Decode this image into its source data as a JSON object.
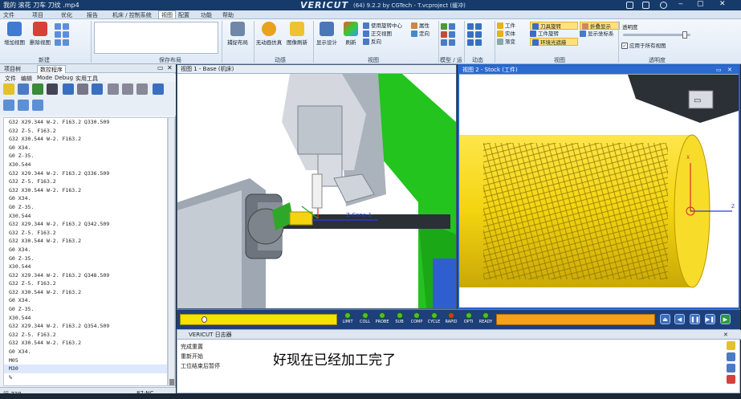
{
  "window": {
    "file_title": "我的 滚花 刀车 刀纹 .mp4",
    "logo": "VERICUT",
    "version": "(64) 9.2.2 by CGTech - T.vcproject (缓冲)"
  },
  "menubar": {
    "items": [
      "文件",
      "项目",
      "优化",
      "报告",
      "机床 / 控制系统",
      "视图",
      "配置",
      "功能",
      "帮助"
    ],
    "active_index": 5
  },
  "ribbon": {
    "groups": [
      {
        "label": "新建",
        "buttons": [
          "增加视图",
          "删除视图"
        ]
      },
      {
        "label": "保存布局",
        "buttons": []
      },
      {
        "label": "",
        "buttons": [
          "捕捉布局"
        ]
      },
      {
        "label": "动感",
        "buttons": [
          "无动画仿真",
          "图像刷新"
        ]
      },
      {
        "label": "视图",
        "buttons": [
          "显示设计",
          "刷新",
          "使用旋转中心",
          "正交视图",
          "反向",
          "属性",
          "定向"
        ]
      },
      {
        "label": "模型 / 运",
        "buttons": []
      },
      {
        "label": "动态",
        "buttons": []
      },
      {
        "label": "视图",
        "buttons": [
          "工件",
          "实体",
          "渐变",
          "刀具旋转",
          "工件旋转",
          "环境光遮蔽",
          "折叠显示",
          "显示坐标系"
        ]
      },
      {
        "label": "透明度",
        "buttons": [
          "透明度",
          "应用于所有视图"
        ]
      }
    ]
  },
  "left_panel": {
    "tabs": [
      "项目树",
      "数控程序"
    ],
    "active_tab": 1,
    "menu": [
      "文件",
      "编辑",
      "Mode",
      "Debug",
      "实用工具"
    ],
    "code_lines": [
      "G32 X29.344 W-2. F163.2 Q330.509",
      "G32 Z-5. F163.2",
      "G32 X30.544 W-2. F163.2",
      "G0 X34.",
      "G0 Z-35.",
      "X30.544",
      "G32 X29.344 W-2. F163.2 Q336.509",
      "G32 Z-5. F163.2",
      "G32 X30.544 W-2. F163.2",
      "G0 X34.",
      "G0 Z-35.",
      "X30.544",
      "G32 X29.344 W-2. F163.2 Q342.509",
      "G32 Z-5. F163.2",
      "G32 X30.544 W-2. F163.2",
      "G0 X34.",
      "G0 Z-35.",
      "X30.544",
      "G32 X29.344 W-2. F163.2 Q348.509",
      "G32 Z-5. F163.2",
      "G32 X30.544 W-2. F163.2",
      "G0 X34.",
      "G0 Z-35.",
      "X30.544",
      "G32 X29.344 W-2. F163.2 Q354.509",
      "G32 Z-5. F163.2",
      "G32 X30.544 W-2. F163.2",
      "G0 X34.",
      "M05",
      "M30",
      "%"
    ],
    "status_line": "行 728",
    "status_right": "87:NC"
  },
  "view1": {
    "title": "视图 1 - Base (机床)",
    "axis_label": "Z-Cone-1"
  },
  "view2": {
    "title": "视图 2 - Stock (工件)",
    "axis_z": "Z",
    "axis_x": "X"
  },
  "sim_controls": {
    "indicators": [
      "LIMIT",
      "COLL",
      "PROBE",
      "SUB",
      "COMP",
      "CYCLE",
      "RAPID",
      "OPTI",
      "READY"
    ],
    "led_colors": [
      "#4cbf34",
      "#4cbf34",
      "#4cbf34",
      "#4cbf34",
      "#4cbf34",
      "#4cbf34",
      "#d6342a",
      "#4cbf34",
      "#4cbf34"
    ]
  },
  "log": {
    "title": "VERICUT 日志器",
    "lines": [
      "完成重置",
      "重新开始",
      "工位结束后暂停"
    ]
  },
  "subtitle": "好现在已经加工完了",
  "colors": {
    "stock": "#f3d40f",
    "machine_green": "#22c41d",
    "accent": "#2c6ad1"
  }
}
